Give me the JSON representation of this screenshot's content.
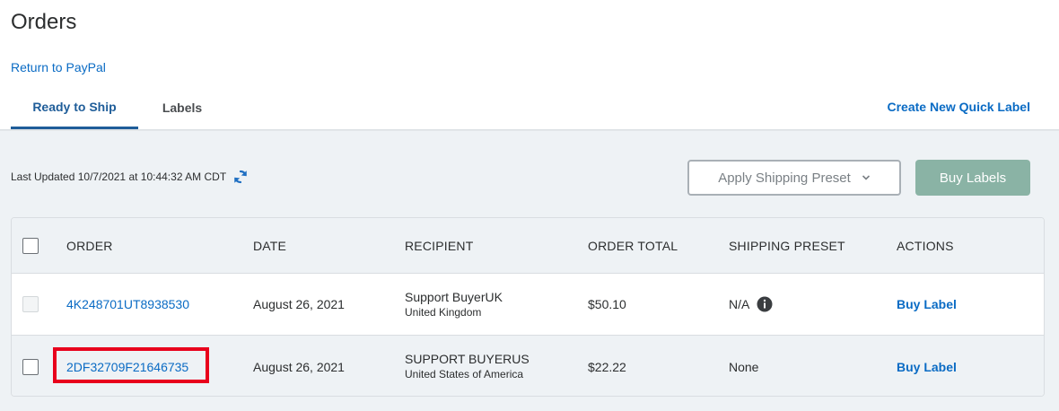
{
  "page": {
    "title": "Orders",
    "return_link": "Return to PayPal"
  },
  "tabs": [
    {
      "label": "Ready to Ship",
      "active": true
    },
    {
      "label": "Labels",
      "active": false
    }
  ],
  "header_actions": {
    "quick_label": "Create New Quick Label"
  },
  "toolbar": {
    "last_updated": "Last Updated 10/7/2021 at 10:44:32 AM CDT",
    "preset_label": "Apply Shipping Preset",
    "buy_labels": "Buy Labels"
  },
  "table": {
    "columns": [
      "ORDER",
      "DATE",
      "RECIPIENT",
      "ORDER TOTAL",
      "SHIPPING PRESET",
      "ACTIONS"
    ],
    "rows": [
      {
        "order": "4K248701UT8938530",
        "date": "August 26, 2021",
        "recipient_name": "Support BuyerUK",
        "recipient_country": "United Kingdom",
        "total": "$50.10",
        "preset": "N/A",
        "action": "Buy Label",
        "checkbox_disabled": true
      },
      {
        "order": "2DF32709F21646735",
        "date": "August 26, 2021",
        "recipient_name": "SUPPORT BUYERUS",
        "recipient_country": "United States of America",
        "total": "$22.22",
        "preset": "None",
        "action": "Buy Label",
        "checkbox_disabled": false
      }
    ]
  },
  "colors": {
    "link": "#0a6bc4",
    "active_tab": "#1f5d99",
    "buy_button": "#8ab3a5",
    "highlight": "#e8001c",
    "panel_bg": "#eef2f5"
  },
  "icons": {
    "refresh": "refresh-icon",
    "chevron": "chevron-down-icon",
    "info": "info-icon"
  }
}
